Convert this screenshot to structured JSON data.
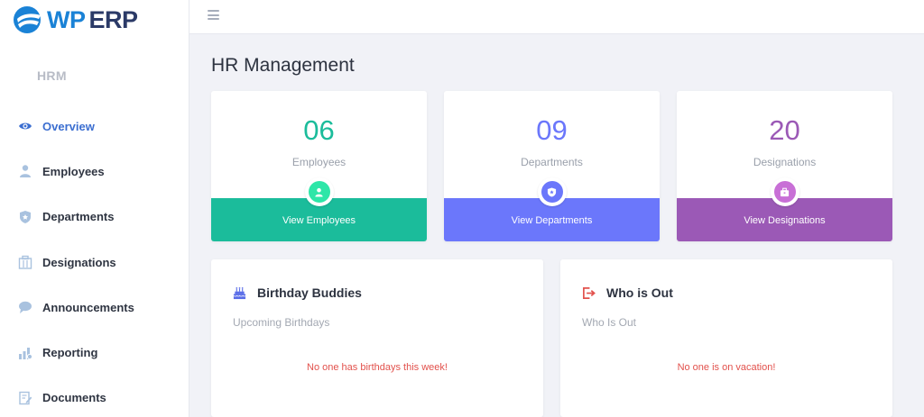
{
  "brand": {
    "wp": "WP",
    "erp": "ERP"
  },
  "sidebar": {
    "section": "HRM",
    "items": [
      {
        "label": "Overview",
        "icon": "eye-icon",
        "active": true
      },
      {
        "label": "Employees",
        "icon": "user-icon"
      },
      {
        "label": "Departments",
        "icon": "shield-icon"
      },
      {
        "label": "Designations",
        "icon": "building-icon"
      },
      {
        "label": "Announcements",
        "icon": "chat-bubble-icon"
      },
      {
        "label": "Reporting",
        "icon": "chart-icon"
      },
      {
        "label": "Documents",
        "icon": "document-edit-icon"
      }
    ]
  },
  "header": {
    "menu_icon": "hamburger-icon"
  },
  "main": {
    "title": "HR Management",
    "stats": [
      {
        "value": "06",
        "label": "Employees",
        "link": "View Employees",
        "color": "#1bbc9b",
        "icon": "user-icon"
      },
      {
        "value": "09",
        "label": "Departments",
        "link": "View Departments",
        "color": "#6b77fb",
        "icon": "shield-icon"
      },
      {
        "value": "20",
        "label": "Designations",
        "link": "View Designations",
        "color": "#9b59b6",
        "icon": "briefcase-icon"
      }
    ],
    "birthday": {
      "title": "Birthday Buddies",
      "subtitle": "Upcoming Birthdays",
      "empty": "No one has birthdays this week!",
      "icon": "cake-icon"
    },
    "out": {
      "title": "Who is Out",
      "subtitle": "Who Is Out",
      "empty": "No one is on vacation!",
      "icon": "sign-out-icon"
    }
  }
}
